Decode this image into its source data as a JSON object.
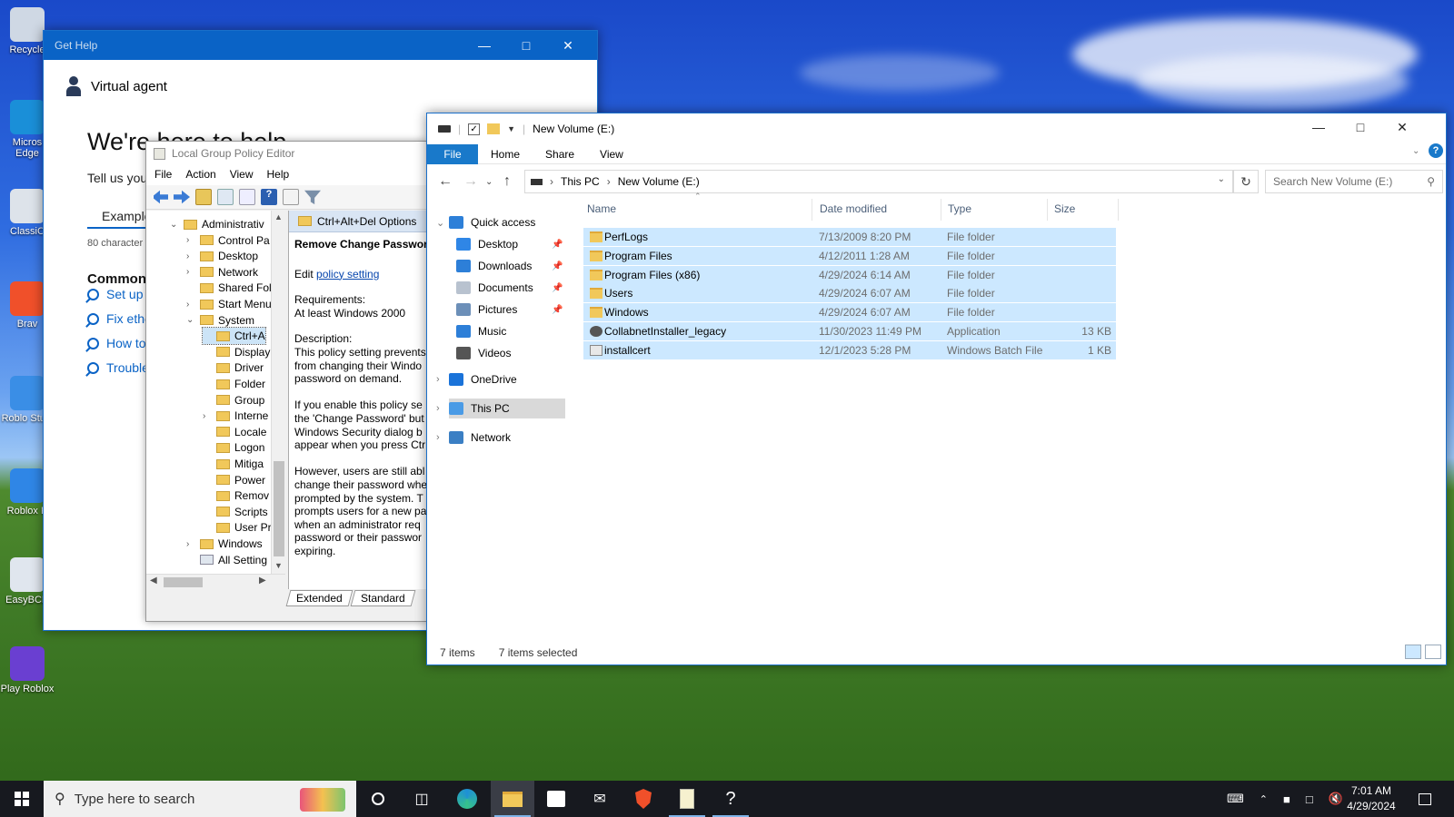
{
  "desktop": {
    "icons": [
      {
        "label": "Recycle"
      },
      {
        "label": "Micros Edge"
      },
      {
        "label": "ClassiC"
      },
      {
        "label": "Brav"
      },
      {
        "label": "Roblo Studi"
      },
      {
        "label": "Roblox P"
      },
      {
        "label": "EasyBCD"
      },
      {
        "label": "Play Roblox"
      }
    ]
  },
  "get_help": {
    "title": "Get Help",
    "agent": "Virtual agent",
    "heading": "We're here to help",
    "tell_us": "Tell us you",
    "example_tab": "Example",
    "char_count": "80 character",
    "common": "Common s",
    "links": [
      "Set up",
      "Fix ethe",
      "How to",
      "Trouble"
    ]
  },
  "gpe": {
    "title": "Local Group Policy Editor",
    "menu": [
      "File",
      "Action",
      "View",
      "Help"
    ],
    "tree": [
      {
        "label": "Administrativ",
        "expand": "open",
        "indent": 0
      },
      {
        "label": "Control Pa",
        "expand": "closed",
        "indent": 1
      },
      {
        "label": "Desktop",
        "expand": "closed",
        "indent": 1
      },
      {
        "label": "Network",
        "expand": "closed",
        "indent": 1
      },
      {
        "label": "Shared Fol",
        "expand": "none",
        "indent": 1
      },
      {
        "label": "Start Menu",
        "expand": "closed",
        "indent": 1
      },
      {
        "label": "System",
        "expand": "open",
        "indent": 1
      },
      {
        "label": "Ctrl+A",
        "expand": "none",
        "indent": 2,
        "selected": true
      },
      {
        "label": "Display",
        "expand": "none",
        "indent": 2
      },
      {
        "label": "Driver",
        "expand": "none",
        "indent": 2
      },
      {
        "label": "Folder",
        "expand": "none",
        "indent": 2
      },
      {
        "label": "Group",
        "expand": "none",
        "indent": 2
      },
      {
        "label": "Interne",
        "expand": "closed",
        "indent": 2
      },
      {
        "label": "Locale",
        "expand": "none",
        "indent": 2
      },
      {
        "label": "Logon",
        "expand": "none",
        "indent": 2
      },
      {
        "label": "Mitiga",
        "expand": "none",
        "indent": 2
      },
      {
        "label": "Power",
        "expand": "none",
        "indent": 2
      },
      {
        "label": "Remov",
        "expand": "none",
        "indent": 2
      },
      {
        "label": "Scripts",
        "expand": "none",
        "indent": 2
      },
      {
        "label": "User Pr",
        "expand": "none",
        "indent": 2
      },
      {
        "label": "Windows",
        "expand": "closed",
        "indent": 1
      },
      {
        "label": "All Setting",
        "expand": "none",
        "indent": 1
      }
    ],
    "detail_header": "Ctrl+Alt+Del Options",
    "setting_title": "Remove Change Password",
    "edit_prefix": "Edit",
    "edit_link": "policy setting",
    "requirements_label": "Requirements:",
    "requirements": "At least Windows 2000",
    "description_label": "Description:",
    "desc_lines": [
      "This policy setting prevents",
      "from changing their Windo",
      "password on demand.",
      "",
      "If you enable this policy se",
      "the 'Change Password' but",
      "Windows Security dialog b",
      "appear when you press Ctr",
      "",
      "However, users are still abl",
      "change their password whe",
      "prompted by the system. T",
      "prompts users for a new pa",
      "when an administrator req",
      "password or their passwor",
      "expiring."
    ],
    "tabs": [
      "Extended",
      "Standard"
    ]
  },
  "explorer": {
    "title": "New Volume (E:)",
    "ribbon": {
      "file": "File",
      "tabs": [
        "Home",
        "Share",
        "View"
      ]
    },
    "breadcrumb": [
      "This PC",
      "New Volume (E:)"
    ],
    "search_placeholder": "Search New Volume (E:)",
    "nav": {
      "quick_access": "Quick access",
      "quick_items": [
        "Desktop",
        "Downloads",
        "Documents",
        "Pictures",
        "Music",
        "Videos"
      ],
      "onedrive": "OneDrive",
      "this_pc": "This PC",
      "network": "Network"
    },
    "columns": [
      "Name",
      "Date modified",
      "Type",
      "Size"
    ],
    "files": [
      {
        "name": "PerfLogs",
        "date": "7/13/2009 8:20 PM",
        "type": "File folder",
        "size": "",
        "kind": "folder"
      },
      {
        "name": "Program Files",
        "date": "4/12/2011 1:28 AM",
        "type": "File folder",
        "size": "",
        "kind": "folder"
      },
      {
        "name": "Program Files (x86)",
        "date": "4/29/2024 6:14 AM",
        "type": "File folder",
        "size": "",
        "kind": "folder"
      },
      {
        "name": "Users",
        "date": "4/29/2024 6:07 AM",
        "type": "File folder",
        "size": "",
        "kind": "folder"
      },
      {
        "name": "Windows",
        "date": "4/29/2024 6:07 AM",
        "type": "File folder",
        "size": "",
        "kind": "folder"
      },
      {
        "name": "CollabnetInstaller_legacy",
        "date": "11/30/2023 11:49 PM",
        "type": "Application",
        "size": "13 KB",
        "kind": "app"
      },
      {
        "name": "installcert",
        "date": "12/1/2023 5:28 PM",
        "type": "Windows Batch File",
        "size": "1 KB",
        "kind": "bat"
      }
    ],
    "status_items": "7 items",
    "status_selected": "7 items selected"
  },
  "taskbar": {
    "search_placeholder": "Type here to search",
    "time": "7:01 AM",
    "date": "4/29/2024"
  },
  "colors": {
    "selection": "#cce8ff",
    "accent": "#1979ca",
    "taskbar": "#17191f"
  }
}
